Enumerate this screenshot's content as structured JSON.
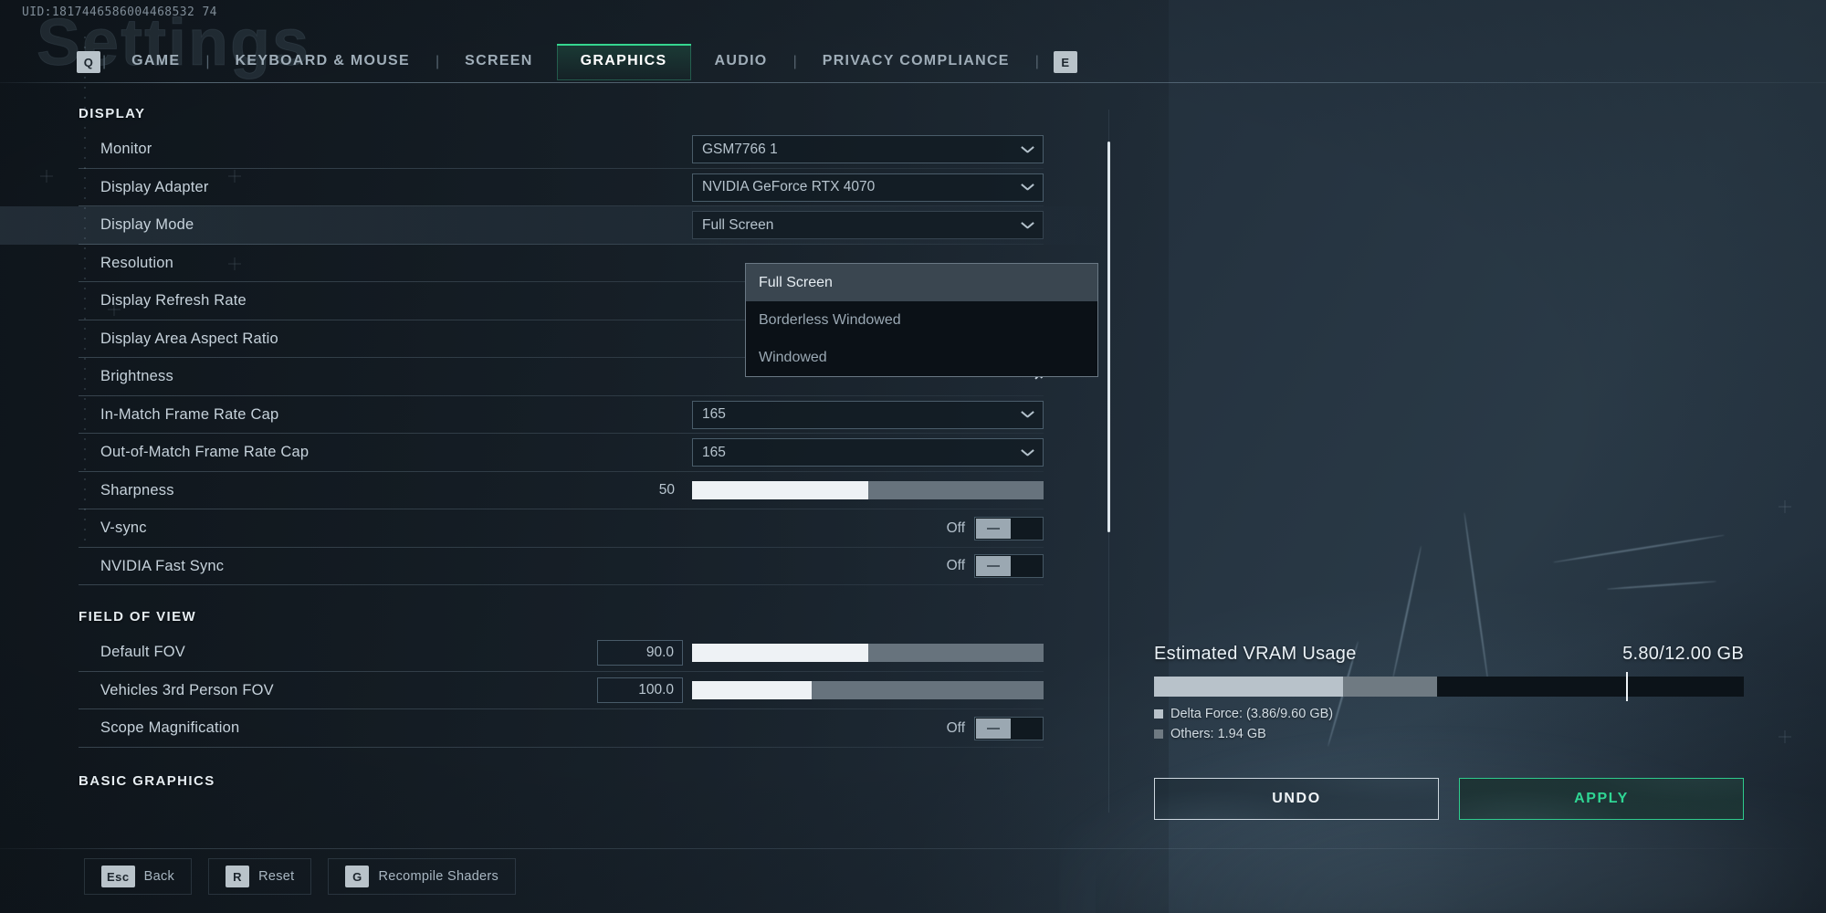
{
  "header": {
    "uid": "UID:1817446586004468532 74",
    "ghost_title": "Settings",
    "left_key": "Q",
    "right_key": "E"
  },
  "tabs": [
    {
      "label": "GAME",
      "active": false
    },
    {
      "label": "KEYBOARD & MOUSE",
      "active": false
    },
    {
      "label": "SCREEN",
      "active": false
    },
    {
      "label": "GRAPHICS",
      "active": true
    },
    {
      "label": "AUDIO",
      "active": false
    },
    {
      "label": "PRIVACY COMPLIANCE",
      "active": false
    }
  ],
  "sections": {
    "display": "DISPLAY",
    "field_of_view": "FIELD OF VIEW",
    "basic_graphics": "BASIC GRAPHICS"
  },
  "rows": {
    "monitor": {
      "label": "Monitor",
      "value": "GSM7766 1"
    },
    "display_adapter": {
      "label": "Display Adapter",
      "value": "NVIDIA GeForce RTX 4070"
    },
    "display_mode": {
      "label": "Display Mode",
      "value": "Full Screen"
    },
    "resolution": {
      "label": "Resolution"
    },
    "display_refresh_rate": {
      "label": "Display Refresh Rate"
    },
    "display_area_aspect_ratio": {
      "label": "Display Area Aspect Ratio"
    },
    "brightness": {
      "label": "Brightness"
    },
    "in_match_frame_rate_cap": {
      "label": "In-Match Frame Rate Cap",
      "value": "165"
    },
    "out_of_match_frame_rate_cap": {
      "label": "Out-of-Match Frame Rate Cap",
      "value": "165"
    },
    "sharpness": {
      "label": "Sharpness",
      "value": "50",
      "fill_percent": 50
    },
    "vsync": {
      "label": "V-sync",
      "state": "Off"
    },
    "nvidia_fast_sync": {
      "label": "NVIDIA Fast Sync",
      "state": "Off"
    },
    "default_fov": {
      "label": "Default FOV",
      "value": "90.0",
      "fill_percent": 50
    },
    "vehicles_3rd_person_fov": {
      "label": "Vehicles 3rd Person FOV",
      "value": "100.0",
      "fill_percent": 34
    },
    "scope_magnification": {
      "label": "Scope Magnification",
      "state": "Off"
    }
  },
  "dropdown": {
    "options": [
      {
        "label": "Full Screen",
        "selected": true
      },
      {
        "label": "Borderless Windowed",
        "selected": false
      },
      {
        "label": "Windowed",
        "selected": false
      }
    ]
  },
  "vram": {
    "title": "Estimated VRAM Usage",
    "amount": "5.80/12.00 GB",
    "used_gb": 5.8,
    "total_gb": 12.0,
    "delta_force_percent": 32,
    "others_percent": 16,
    "marker_percent": 80,
    "legend": [
      {
        "label": "Delta Force: (3.86/9.60 GB)",
        "color": "#b8c2ca"
      },
      {
        "label": "Others: 1.94 GB",
        "color": "#6f7a82"
      }
    ]
  },
  "actions": {
    "undo": "UNDO",
    "apply": "APPLY"
  },
  "footer": [
    {
      "key": "Esc",
      "label": "Back"
    },
    {
      "key": "R",
      "label": "Reset"
    },
    {
      "key": "G",
      "label": "Recompile Shaders"
    }
  ],
  "colors": {
    "accent_green": "#2ecb8c",
    "text_primary": "#e6edf2",
    "text_secondary": "#b6c3cd",
    "panel_bg": "#0b1117"
  }
}
